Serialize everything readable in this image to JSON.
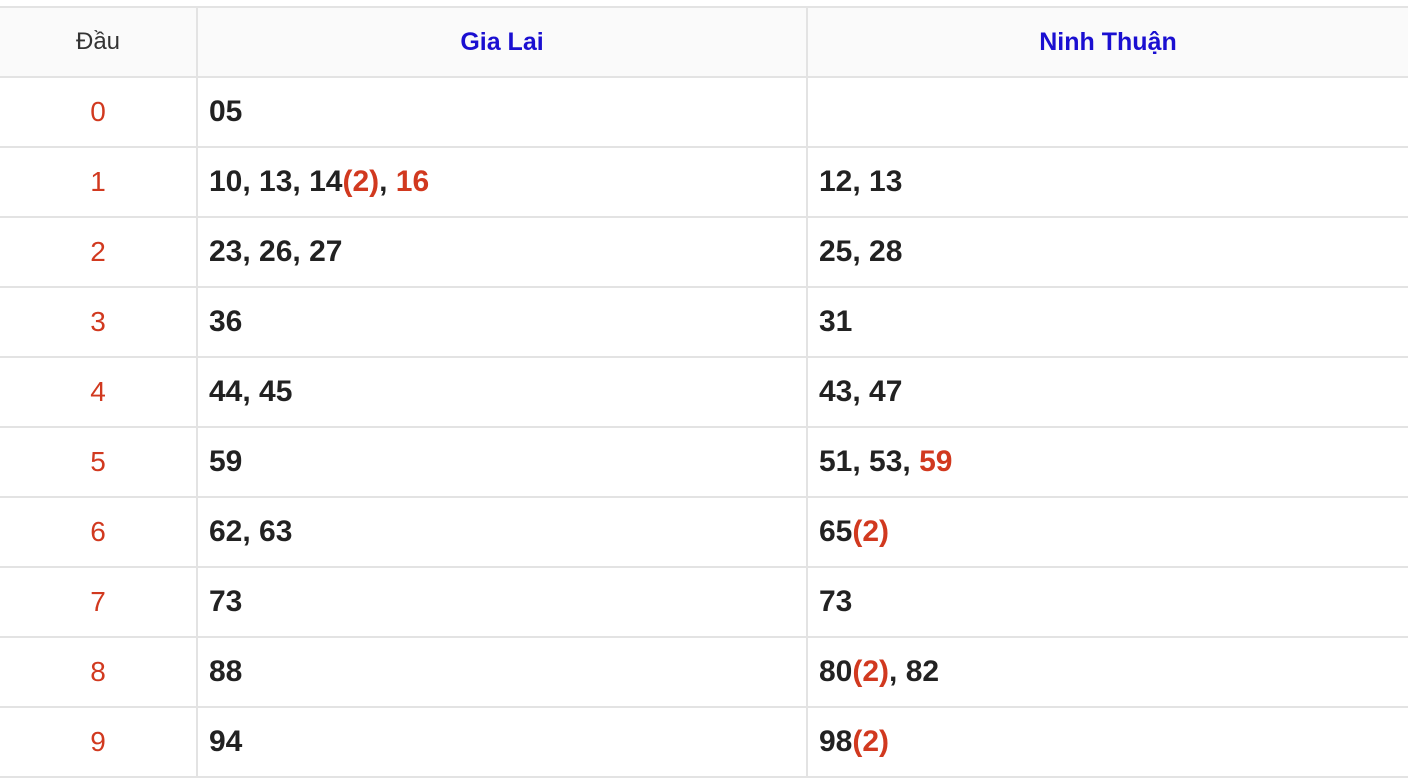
{
  "header": {
    "dau_label": "Đầu",
    "col1_title": "Gia Lai",
    "col2_title": "Ninh Thuận"
  },
  "colors": {
    "title_blue": "#1a0fd1",
    "accent_red": "#d1391f",
    "text_dark": "#222222",
    "border": "#e3e3e3"
  },
  "rows": [
    {
      "dau": "0",
      "col1": [
        {
          "text": "05"
        }
      ],
      "col2": []
    },
    {
      "dau": "1",
      "col1": [
        {
          "text": "10, 13, 14"
        },
        {
          "text": "(2)",
          "hl": true
        },
        {
          "text": ", "
        },
        {
          "text": "16",
          "hl": true
        }
      ],
      "col2": [
        {
          "text": "12, 13"
        }
      ]
    },
    {
      "dau": "2",
      "col1": [
        {
          "text": "23, 26, 27"
        }
      ],
      "col2": [
        {
          "text": "25, 28"
        }
      ]
    },
    {
      "dau": "3",
      "col1": [
        {
          "text": "36"
        }
      ],
      "col2": [
        {
          "text": "31"
        }
      ]
    },
    {
      "dau": "4",
      "col1": [
        {
          "text": "44, 45"
        }
      ],
      "col2": [
        {
          "text": "43, 47"
        }
      ]
    },
    {
      "dau": "5",
      "col1": [
        {
          "text": "59"
        }
      ],
      "col2": [
        {
          "text": "51, 53, "
        },
        {
          "text": "59",
          "hl": true
        }
      ]
    },
    {
      "dau": "6",
      "col1": [
        {
          "text": "62, 63"
        }
      ],
      "col2": [
        {
          "text": "65"
        },
        {
          "text": "(2)",
          "hl": true
        }
      ]
    },
    {
      "dau": "7",
      "col1": [
        {
          "text": "73"
        }
      ],
      "col2": [
        {
          "text": "73"
        }
      ]
    },
    {
      "dau": "8",
      "col1": [
        {
          "text": "88"
        }
      ],
      "col2": [
        {
          "text": "80"
        },
        {
          "text": "(2)",
          "hl": true
        },
        {
          "text": ", 82"
        }
      ]
    },
    {
      "dau": "9",
      "col1": [
        {
          "text": "94"
        }
      ],
      "col2": [
        {
          "text": "98"
        },
        {
          "text": "(2)",
          "hl": true
        }
      ]
    }
  ]
}
